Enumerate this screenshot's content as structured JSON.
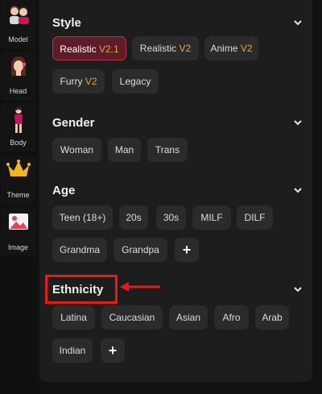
{
  "sidebar": {
    "items": [
      {
        "label": "Model",
        "icon": "avatars-icon"
      },
      {
        "label": "Head",
        "icon": "head-portrait-icon"
      },
      {
        "label": "Body",
        "icon": "body-figure-icon"
      },
      {
        "label": "Theme",
        "icon": "crown-icon"
      },
      {
        "label": "Image",
        "icon": "picture-icon"
      }
    ]
  },
  "sections": {
    "style": {
      "title": "Style",
      "options": [
        {
          "name": "Realistic",
          "version": "V2.1",
          "selected": true
        },
        {
          "name": "Realistic",
          "version": "V2"
        },
        {
          "name": "Anime",
          "version": "V2"
        },
        {
          "name": "Furry",
          "version": "V2"
        },
        {
          "name": "Legacy",
          "version": ""
        }
      ]
    },
    "gender": {
      "title": "Gender",
      "options": [
        "Woman",
        "Man",
        "Trans"
      ]
    },
    "age": {
      "title": "Age",
      "options": [
        "Teen (18+)",
        "20s",
        "30s",
        "MILF",
        "DILF",
        "Grandma",
        "Grandpa"
      ],
      "add_label": "+"
    },
    "ethnicity": {
      "title": "Ethnicity",
      "options": [
        "Latina",
        "Caucasian",
        "Asian",
        "Afro",
        "Arab",
        "Indian"
      ],
      "add_label": "+"
    }
  },
  "colors": {
    "accent_selected_bg": "#5e1c2a",
    "accent_selected_border": "#b03449",
    "version_text": "#e2a53a",
    "annotation_red": "#e51b1b"
  }
}
